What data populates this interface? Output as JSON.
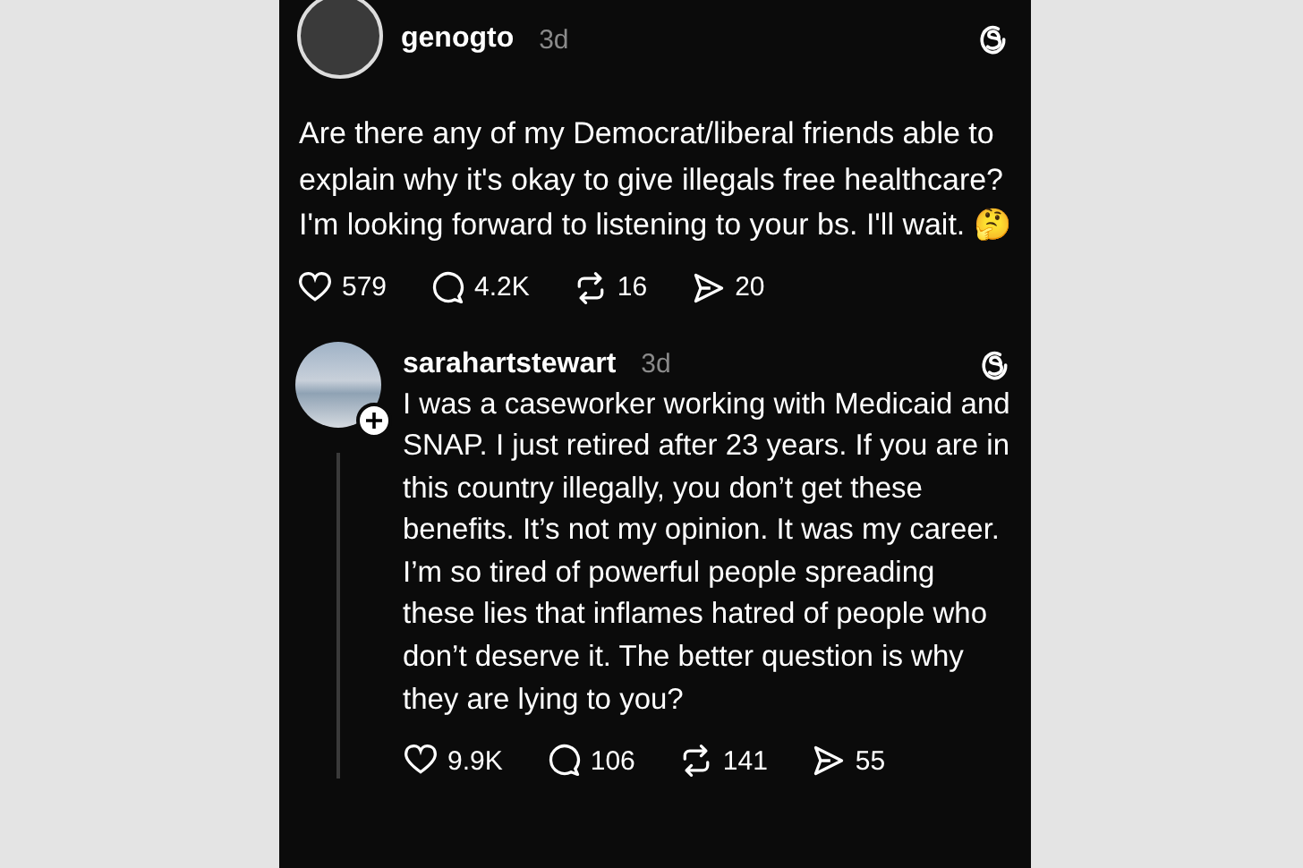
{
  "posts": [
    {
      "username": "genogto",
      "time": "3d",
      "text": "Are there any of my Democrat/liberal friends able to explain why it's okay to give illegals free healthcare? I'm looking forward to listening to your bs. I'll wait. 🤔",
      "is_reply": false,
      "stats": [
        {
          "kind": "like",
          "count": "579"
        },
        {
          "kind": "reply",
          "count": "4.2K"
        },
        {
          "kind": "repost",
          "count": "16"
        },
        {
          "kind": "share",
          "count": "20"
        }
      ]
    },
    {
      "username": "sarahartstewart",
      "time": "3d",
      "text": "I was a caseworker working with Medicaid and SNAP. I just retired after 23 years. If you are in this country illegally, you don’t get these benefits. It’s not my opinion. It was my career. I’m so tired of powerful people spreading these lies that inflames hatred of people who don’t deserve it. The better question is why they are lying to you?",
      "is_reply": true,
      "stats": [
        {
          "kind": "like",
          "count": "9.9K"
        },
        {
          "kind": "reply",
          "count": "106"
        },
        {
          "kind": "repost",
          "count": "141"
        },
        {
          "kind": "share",
          "count": "55"
        }
      ]
    }
  ]
}
